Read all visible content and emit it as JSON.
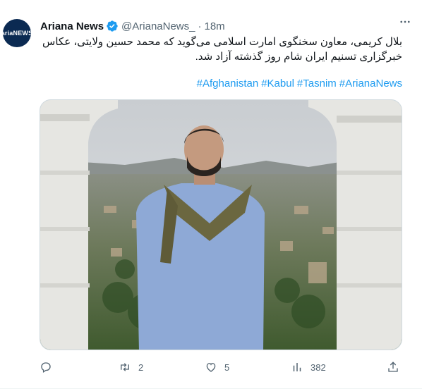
{
  "tweet": {
    "author_name": "Ariana News",
    "avatar_text": "ariaNEWS",
    "handle": "@ArianaNews_",
    "separator": "·",
    "time": "18m",
    "text": "بلال کریمی، معاون سخنگوی امارت اسلامی می‌گوید که محمد حسین ولایتی، عکاس خبرگزاری تسنیم ایران شام روز گذشته آزاد شد.",
    "hashtags": [
      "#Afghanistan",
      "#Kabul",
      "#Tasnim",
      "#ArianaNews"
    ],
    "more_icon": "ellipsis-icon"
  },
  "actions": {
    "reply": {
      "icon": "reply-icon",
      "count": ""
    },
    "retweet": {
      "icon": "retweet-icon",
      "count": "2"
    },
    "like": {
      "icon": "heart-icon",
      "count": "5"
    },
    "views": {
      "icon": "views-icon",
      "count": "382"
    },
    "share": {
      "icon": "share-icon",
      "count": ""
    }
  },
  "colors": {
    "accent": "#1d9bf0",
    "secondary_text": "#536471",
    "avatar_bg": "#0b2a52"
  }
}
